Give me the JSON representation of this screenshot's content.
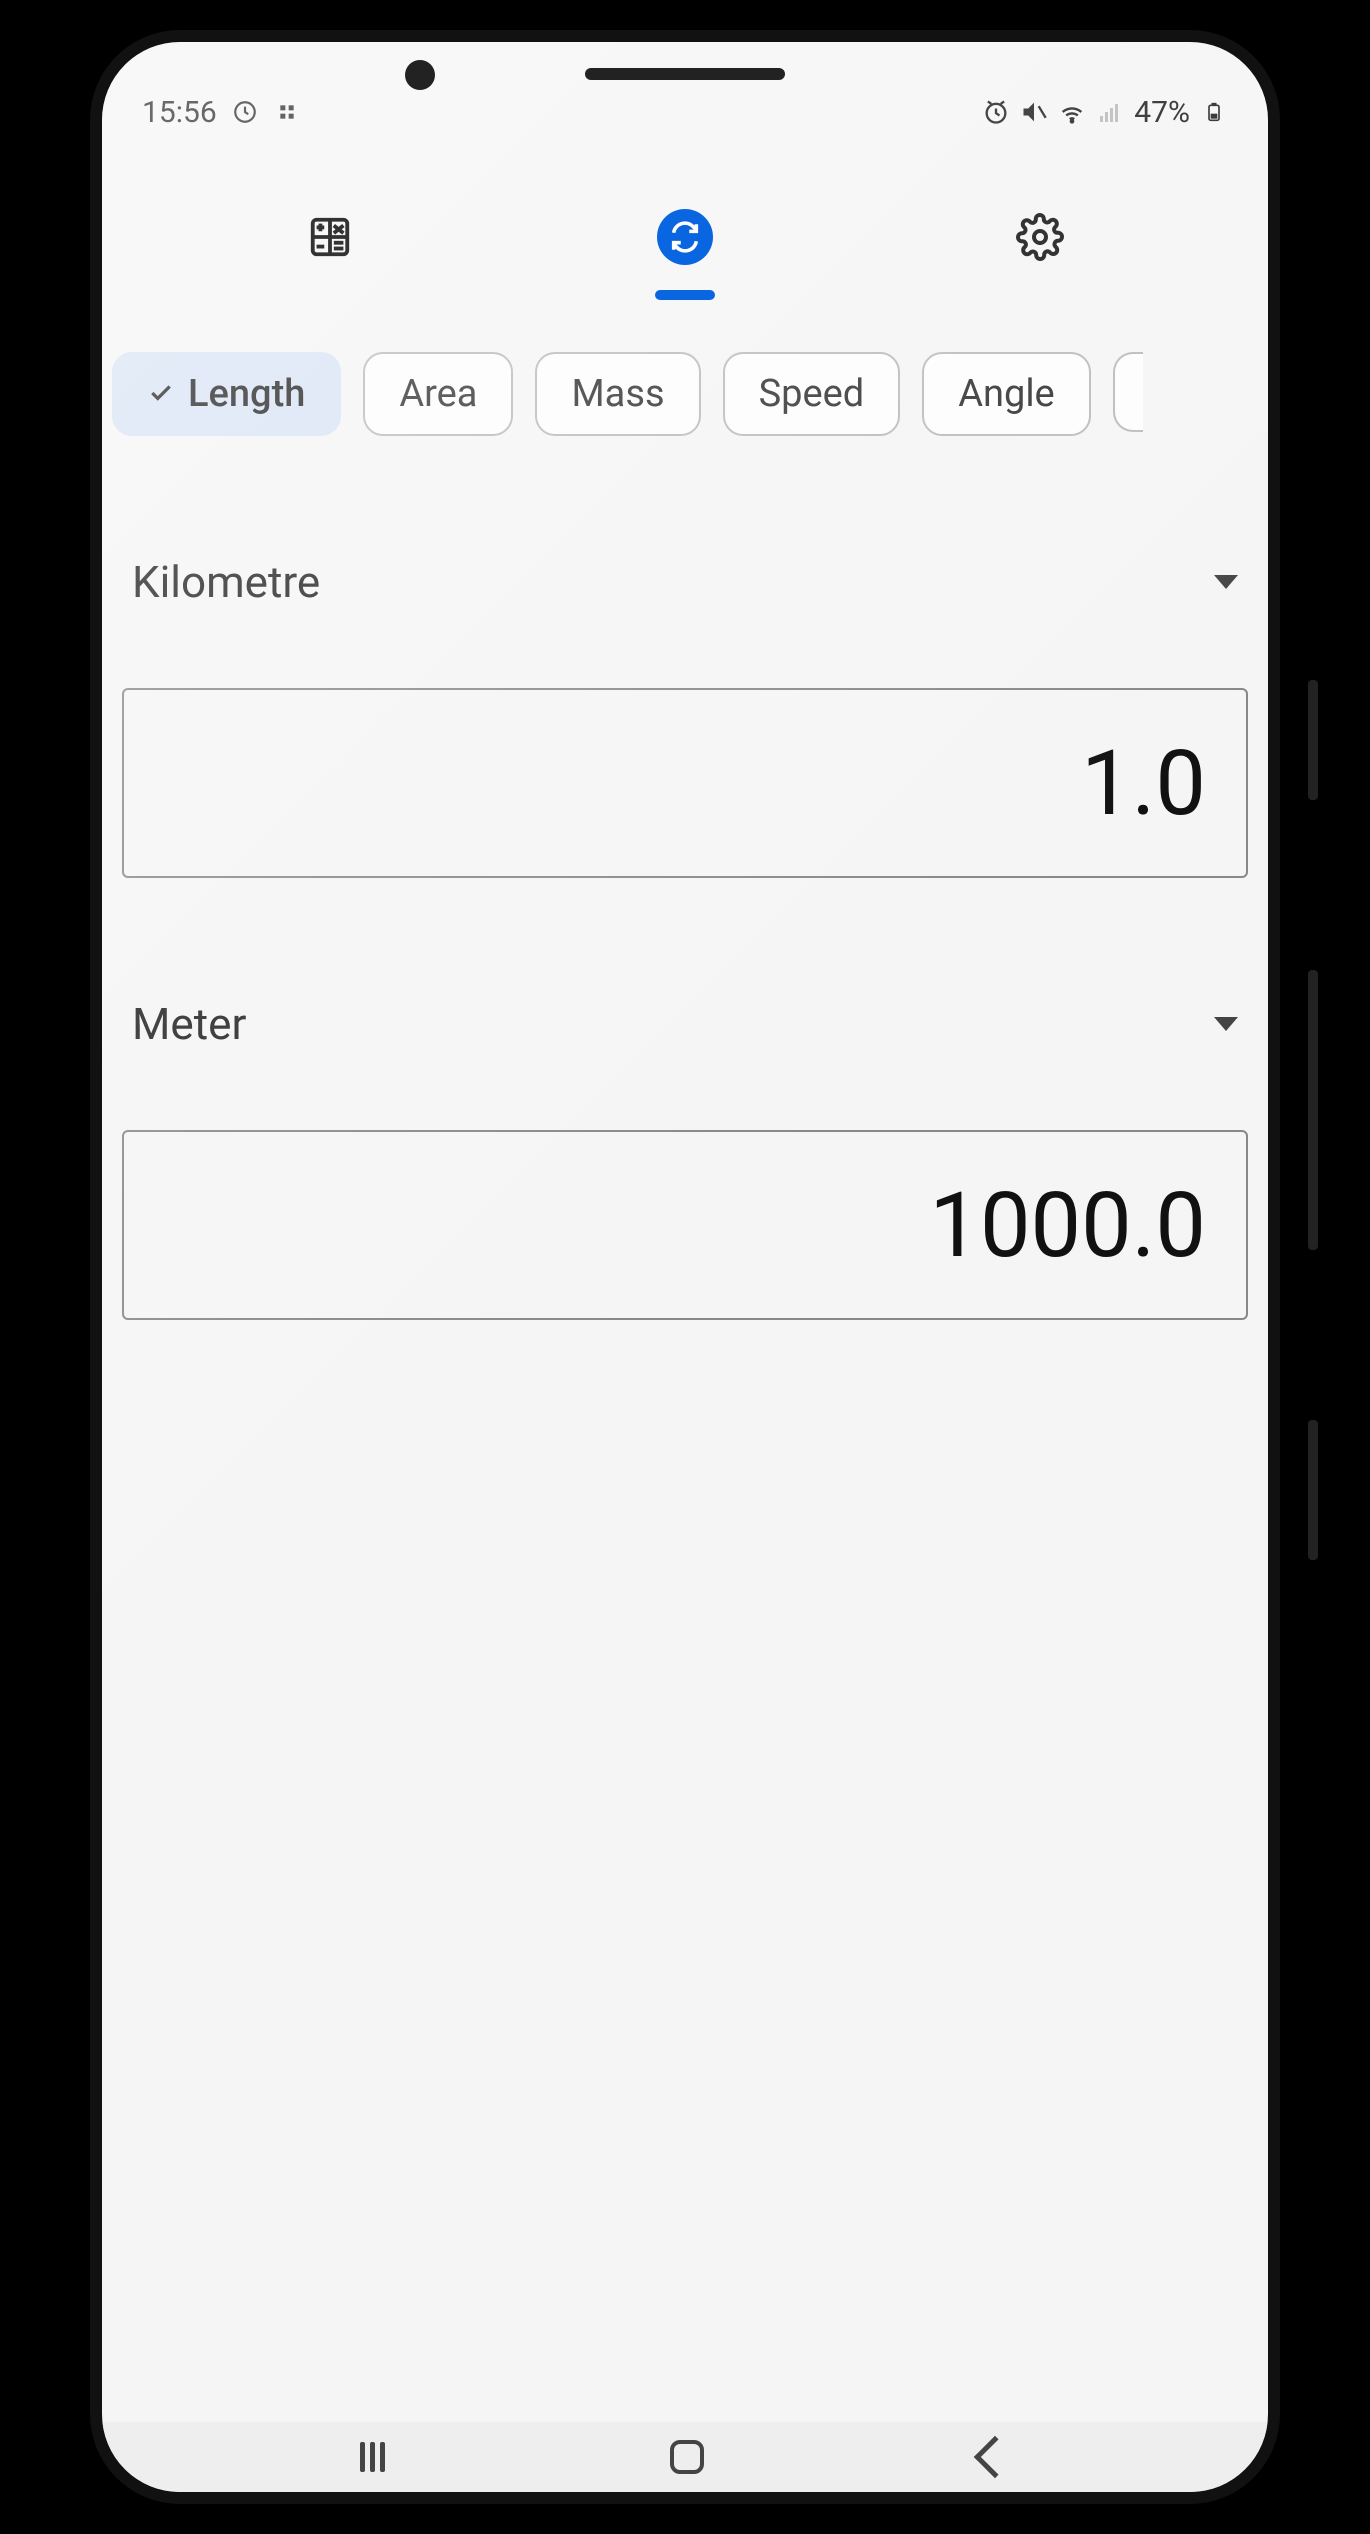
{
  "status_bar": {
    "time": "15:56",
    "battery_text": "47%"
  },
  "top_tabs": {
    "calculator_active": false,
    "converter_active": true
  },
  "categories": [
    {
      "label": "Length",
      "selected": true
    },
    {
      "label": "Area",
      "selected": false
    },
    {
      "label": "Mass",
      "selected": false
    },
    {
      "label": "Speed",
      "selected": false
    },
    {
      "label": "Angle",
      "selected": false
    }
  ],
  "from": {
    "unit": "Kilometre",
    "value": "1.0"
  },
  "to": {
    "unit": "Meter",
    "value": "1000.0"
  }
}
